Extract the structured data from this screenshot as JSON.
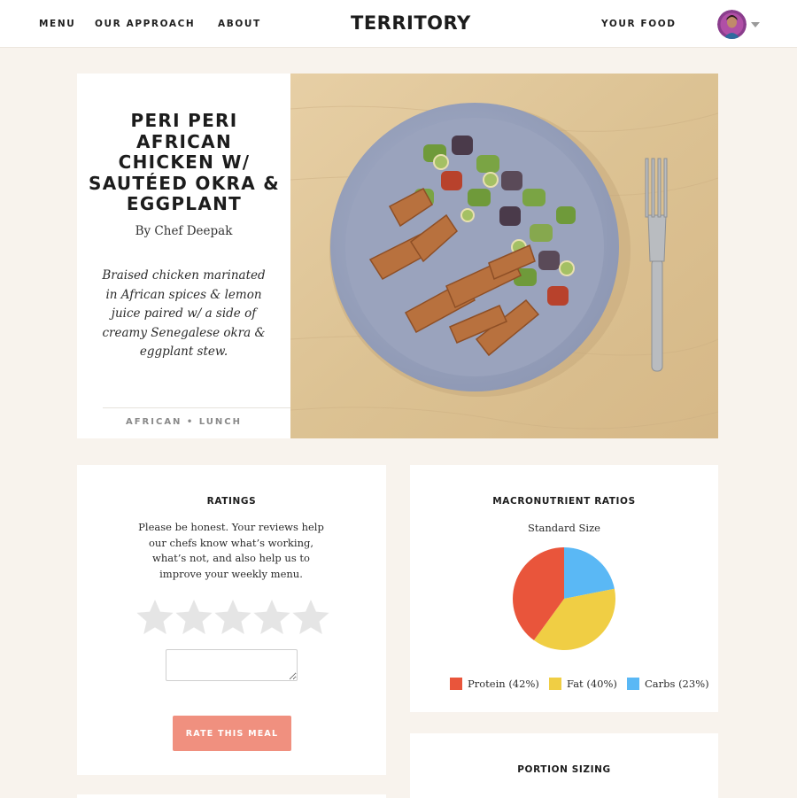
{
  "nav": {
    "menu": "MENU",
    "our_approach": "OUR APPROACH",
    "about": "ABOUT",
    "logo": "TERRITORY",
    "your_food": "YOUR FOOD",
    "avatar_icon": "user-avatar-icon",
    "dropdown_icon": "chevron-down-icon"
  },
  "meal": {
    "title": "PERI PERI AFRICAN CHICKEN W/ SAUTÉED OKRA & EGGPLANT",
    "chef": "By Chef Deepak",
    "description": "Braised chicken marinated in African spices & lemon juice paired w/ a side of creamy Senegalese okra & eggplant stew.",
    "tags": "AFRICAN • LUNCH"
  },
  "ratings": {
    "title": "RATINGS",
    "text": "Please be honest. Your reviews help our chefs know what’s working, what’s not, and also help us to improve your weekly menu.",
    "stars_selected": 0,
    "stars_total": 5,
    "review_value": "",
    "button": "RATE THIS MEAL"
  },
  "macros": {
    "title": "MACRONUTRIENT RATIOS",
    "subtitle": "Standard Size"
  },
  "portion": {
    "title": "PORTION SIZING"
  },
  "colors": {
    "accent": "#f0907f",
    "protein": "#e9553b",
    "fat": "#f0ce44",
    "carbs": "#5ab8f5",
    "page_bg": "#f8f3ed"
  },
  "chart_data": {
    "type": "pie",
    "labels": [
      "Protein (42%)",
      "Fat (40%)",
      "Carbs (23%)"
    ],
    "categories": [
      "Protein",
      "Fat",
      "Carbs"
    ],
    "values": [
      42,
      40,
      23
    ],
    "colors": [
      "#e9553b",
      "#f0ce44",
      "#5ab8f5"
    ],
    "title": "MACRONUTRIENT RATIOS",
    "subtitle": "Standard Size",
    "legend": "bottom"
  }
}
